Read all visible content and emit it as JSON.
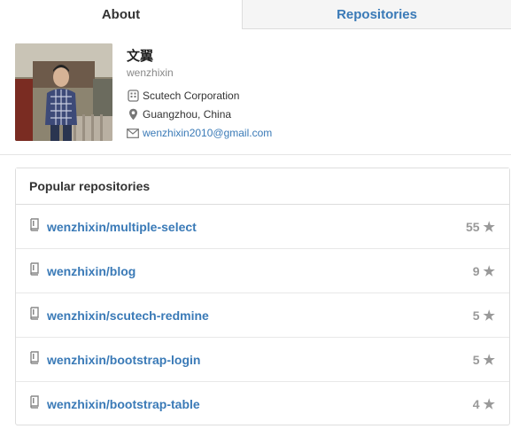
{
  "tabs": [
    {
      "label": "About",
      "active": true
    },
    {
      "label": "Repositories",
      "active": false
    }
  ],
  "profile": {
    "display_name": "文翼",
    "username": "wenzhixin",
    "organization": "Scutech Corporation",
    "location": "Guangzhou, China",
    "email": "wenzhixin2010@gmail.com"
  },
  "popular": {
    "title": "Popular repositories",
    "repos": [
      {
        "name": "wenzhixin/multiple-select",
        "stars": "55"
      },
      {
        "name": "wenzhixin/blog",
        "stars": "9"
      },
      {
        "name": "wenzhixin/scutech-redmine",
        "stars": "5"
      },
      {
        "name": "wenzhixin/bootstrap-login",
        "stars": "5"
      },
      {
        "name": "wenzhixin/bootstrap-table",
        "stars": "4"
      }
    ]
  },
  "icons": {
    "organization": "organization-icon",
    "location": "location-pin-icon",
    "email": "mail-icon",
    "repo": "repo-book-icon",
    "star": "star-icon"
  },
  "colors": {
    "link": "#3a7ab7",
    "inactive_tab_bg": "#f5f5f5",
    "star": "#999999"
  }
}
